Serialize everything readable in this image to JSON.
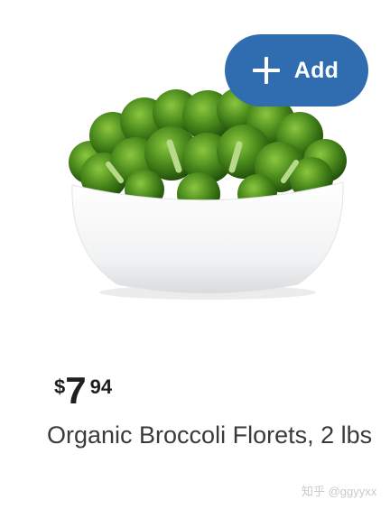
{
  "product": {
    "add_button_label": "Add",
    "price": {
      "currency": "$",
      "dollars": "7",
      "cents": "94"
    },
    "title": "Organic Broccoli Florets, 2 lbs",
    "image_icon": "broccoli-bowl-photo"
  },
  "watermark": "知乎 @ggyyxx",
  "colors": {
    "add_button_bg": "#2f6cb0",
    "price_text": "#1f1f1f",
    "title_text": "#3a3a3a"
  }
}
